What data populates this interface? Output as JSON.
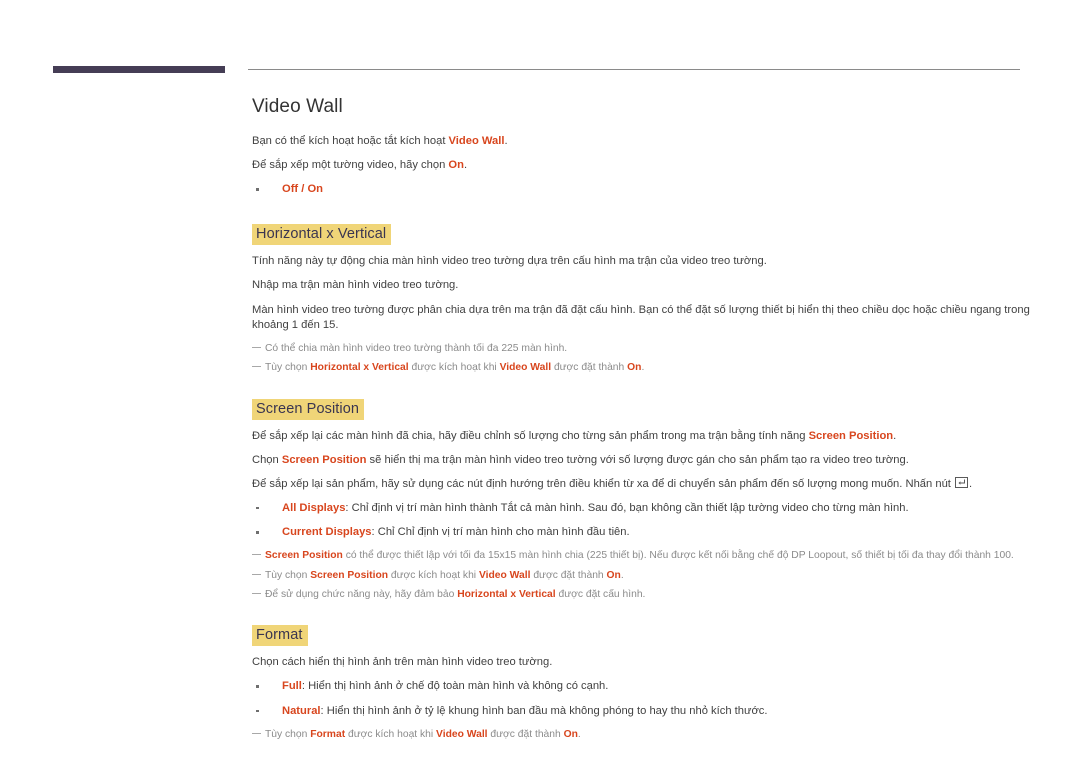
{
  "page": {
    "title": "Video Wall",
    "accent_color": "#d8461e",
    "highlight_color": "#f0d578",
    "rule_color": "#453d55",
    "body_color": "#414141",
    "note_color": "#8b8b8b"
  },
  "intro": {
    "line1_pre": "Bạn có thể kích hoạt hoặc tắt kích hoạt ",
    "line1_em": "Video Wall",
    "line1_post": ".",
    "line2_pre": "Để sắp xếp một tường video, hãy chọn ",
    "line2_em": "On",
    "line2_post": ".",
    "bullet1": "Off / On"
  },
  "sections": [
    {
      "id": "horizontal-x-vertical",
      "heading": "Horizontal x Vertical",
      "paragraphs": [
        "Tính năng này tự động chia màn hình video treo tường dựa trên cấu hình ma trận của video treo tường.",
        "Nhập ma trận màn hình video treo tường.",
        "Màn hình video treo tường được phân chia dựa trên ma trận đã đặt cấu hình. Bạn có thể đặt số lượng thiết bị hiển thị theo chiều dọc hoặc chiều ngang trong khoảng 1 đến 15."
      ],
      "notes": [
        {
          "segments": [
            {
              "text": "Có thể chia màn hình video treo tường thành tối đa 225 màn hình.",
              "style": "plain"
            }
          ]
        },
        {
          "segments": [
            {
              "text": "Tùy chọn ",
              "style": "plain"
            },
            {
              "text": "Horizontal x Vertical",
              "style": "em"
            },
            {
              "text": " được kích hoạt khi ",
              "style": "plain"
            },
            {
              "text": "Video Wall",
              "style": "em"
            },
            {
              "text": " được đặt thành ",
              "style": "plain"
            },
            {
              "text": "On",
              "style": "em"
            },
            {
              "text": ".",
              "style": "plain"
            }
          ]
        }
      ]
    },
    {
      "id": "screen-position",
      "heading": "Screen Position",
      "rich_paragraphs": [
        [
          {
            "text": "Để sắp xếp lại các màn hình đã chia, hãy điều chỉnh số lượng cho từng sản phẩm trong ma trận bằng tính năng ",
            "style": "plain"
          },
          {
            "text": "Screen Position",
            "style": "em"
          },
          {
            "text": ".",
            "style": "plain"
          }
        ],
        [
          {
            "text": "Chọn ",
            "style": "plain"
          },
          {
            "text": "Screen Position",
            "style": "em"
          },
          {
            "text": " sẽ hiển thị ma trận màn hình video treo tường với số lượng được gán cho sản phẩm tạo ra video treo tường.",
            "style": "plain"
          }
        ],
        [
          {
            "text": "Để sắp xếp lại sản phẩm, hãy sử dụng các nút định hướng trên điều khiển từ xa để di chuyển sản phẩm đến số lượng mong muốn. Nhấn nút ",
            "style": "plain"
          },
          {
            "text": "",
            "style": "enter-key"
          },
          {
            "text": ".",
            "style": "plain"
          }
        ]
      ],
      "bullets": [
        [
          {
            "text": "All Displays",
            "style": "em"
          },
          {
            "text": ": Chỉ định vị trí màn hình thành Tắt cả màn hình. Sau đó, bạn không cần thiết lập tường video cho từng màn hình.",
            "style": "plain"
          }
        ],
        [
          {
            "text": "Current Displays",
            "style": "em"
          },
          {
            "text": ": Chỉ Chỉ định vị trí màn hình cho màn hình đầu tiên.",
            "style": "plain"
          }
        ]
      ],
      "notes": [
        {
          "segments": [
            {
              "text": "Screen Position",
              "style": "em"
            },
            {
              "text": " có thể được thiết lập với tối đa 15x15 màn hình chia (225 thiết bị). Nếu được kết nối bằng chế độ DP Loopout, số thiết bị tối đa thay đổi thành 100.",
              "style": "plain"
            }
          ]
        },
        {
          "segments": [
            {
              "text": "Tùy chọn ",
              "style": "plain"
            },
            {
              "text": "Screen Position",
              "style": "em"
            },
            {
              "text": " được kích hoạt khi ",
              "style": "plain"
            },
            {
              "text": "Video Wall",
              "style": "em"
            },
            {
              "text": " được đặt thành ",
              "style": "plain"
            },
            {
              "text": "On",
              "style": "em"
            },
            {
              "text": ".",
              "style": "plain"
            }
          ]
        },
        {
          "segments": [
            {
              "text": "Để sử dụng chức năng này, hãy đảm bảo ",
              "style": "plain"
            },
            {
              "text": "Horizontal x Vertical",
              "style": "em"
            },
            {
              "text": " được đặt cấu hình.",
              "style": "plain"
            }
          ]
        }
      ]
    },
    {
      "id": "format",
      "heading": "Format",
      "rich_paragraphs": [
        [
          {
            "text": "Chọn cách hiển thị hình ảnh trên màn hình video treo tường.",
            "style": "plain"
          }
        ]
      ],
      "bullets": [
        [
          {
            "text": "Full",
            "style": "em"
          },
          {
            "text": ": Hiển thị hình ảnh ở chế độ toàn màn hình và không có cạnh.",
            "style": "plain"
          }
        ],
        [
          {
            "text": "Natural",
            "style": "em"
          },
          {
            "text": ": Hiển thị hình ảnh ở tỷ lệ khung hình ban đầu mà không phóng to hay thu nhỏ kích thước.",
            "style": "plain"
          }
        ]
      ],
      "notes": [
        {
          "segments": [
            {
              "text": "Tùy chọn ",
              "style": "plain"
            },
            {
              "text": "Format",
              "style": "em"
            },
            {
              "text": " được kích hoạt khi ",
              "style": "plain"
            },
            {
              "text": "Video Wall",
              "style": "em"
            },
            {
              "text": " được đặt thành ",
              "style": "plain"
            },
            {
              "text": "On",
              "style": "em"
            },
            {
              "text": ".",
              "style": "plain"
            }
          ]
        }
      ]
    }
  ],
  "icons": {
    "enter_key": "enter-key-icon"
  }
}
